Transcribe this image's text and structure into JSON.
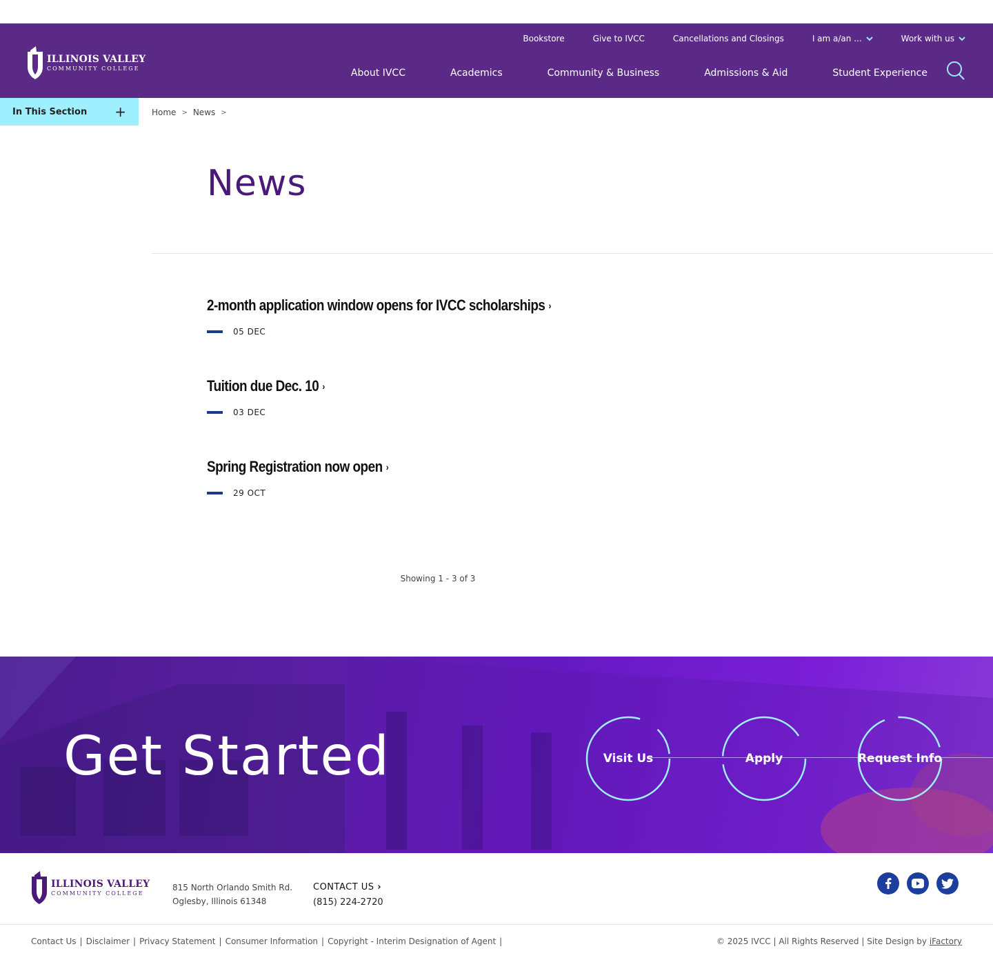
{
  "header": {
    "logo_line1": "ILLINOIS VALLEY",
    "logo_line2": "COMMUNITY COLLEGE",
    "utility_nav": [
      {
        "label": "Bookstore"
      },
      {
        "label": "Give to IVCC"
      },
      {
        "label": "Cancellations and Closings"
      },
      {
        "label": "I am a/an ..."
      },
      {
        "label": "Work with us"
      }
    ],
    "main_nav": [
      {
        "label": "About IVCC"
      },
      {
        "label": "Academics"
      },
      {
        "label": "Community & Business"
      },
      {
        "label": "Admissions & Aid"
      },
      {
        "label": "Student Experience"
      }
    ],
    "search_icon": "search-icon"
  },
  "section_toggle": {
    "label": "In This Section",
    "icon": "+"
  },
  "breadcrumb": {
    "home": "Home",
    "news": "News",
    "sep": ">"
  },
  "page": {
    "title": "News"
  },
  "news": [
    {
      "title": "2-month application window opens for IVCC scholarships",
      "date": "05 DEC"
    },
    {
      "title": "Tuition due Dec. 10",
      "date": "03 DEC"
    },
    {
      "title": "Spring Registration now open",
      "date": "29 OCT"
    }
  ],
  "pagination": {
    "showing": "Showing 1 - 3 of 3"
  },
  "cta": {
    "title": "Get Started",
    "buttons": [
      {
        "label": "Visit Us"
      },
      {
        "label": "Apply"
      },
      {
        "label": "Request Info"
      }
    ]
  },
  "footer": {
    "logo_line1": "ILLINOIS VALLEY",
    "logo_line2": "COMMUNITY COLLEGE",
    "address_line1": "815 North Orlando Smith Rd.",
    "address_line2": "Oglesby, Illinois 61348",
    "contact_label": "CONTACT US",
    "phone": "(815) 224-2720",
    "social": [
      {
        "label": "f"
      },
      {
        "label": "▶"
      },
      {
        "label": "🐦"
      }
    ],
    "legal": [
      {
        "label": "Contact Us"
      },
      {
        "label": "Disclaimer"
      },
      {
        "label": "Privacy Statement"
      },
      {
        "label": "Consumer Information"
      },
      {
        "label": "Copyright - Interim Designation of Agent"
      }
    ],
    "copyright_text": "© 2025 IVCC | All Rights Reserved | Site Design by ",
    "design_by": "iFactory"
  },
  "colors": {
    "brand_purple": "#5b2a86",
    "accent_cyan": "#9ff0ff",
    "dark_blue": "#1c3f9e"
  }
}
